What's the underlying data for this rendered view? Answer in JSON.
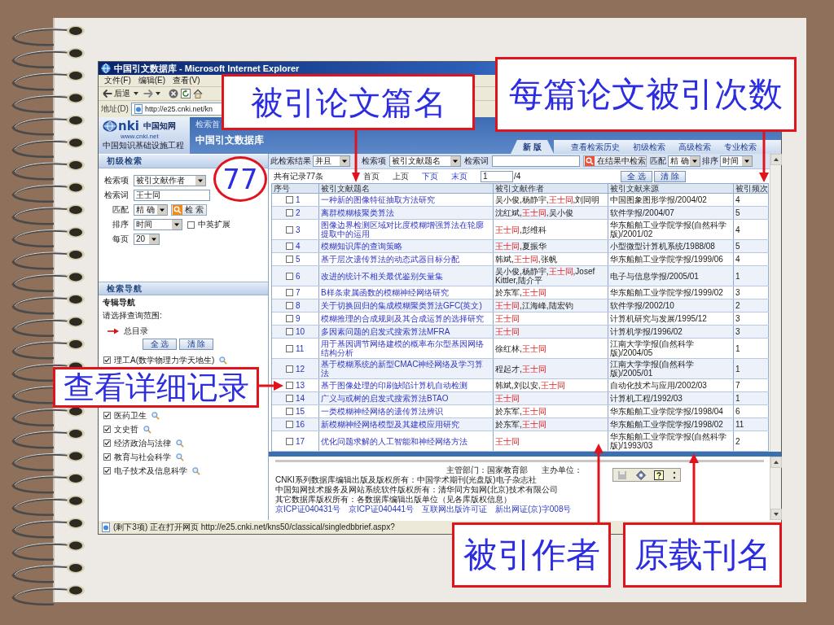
{
  "browser": {
    "title": "中国引文数据库 - Microsoft Internet Explorer",
    "menus": [
      "文件(F)",
      "编辑(E)",
      "查看(V)"
    ],
    "back": "后退",
    "address_label": "地址(D)",
    "url": "http://e25.cnki.net/kn",
    "status": "(剩下3项) 正在打开网页 http://e25.cnki.net/kns50/classical/singledbbrief.aspx?"
  },
  "site_header": {
    "logo": {
      "mark": "nki",
      "name": "中国知网",
      "url": "www.cnki.net",
      "tagline": "中国知识基础设施工程"
    },
    "home_link": "检索首",
    "database": "中国引文数据库",
    "version_tab": "新 版",
    "links": [
      "查看检索历史",
      "初级检索",
      "高级检索",
      "专业检索"
    ]
  },
  "basic_search": {
    "title": "初级检索",
    "field": {
      "label": "检索项",
      "value": "被引文献作者"
    },
    "term": {
      "label": "检索词",
      "value": "王士同"
    },
    "match": {
      "label": "匹配",
      "value": "精 确"
    },
    "search_button": "检 索",
    "sort": {
      "label": "排序",
      "value": "时间"
    },
    "expand": {
      "label": "中英扩展",
      "checked": false
    },
    "per_page": {
      "label": "每页",
      "value": "20"
    }
  },
  "navigation": {
    "title": "检索导航",
    "heading": "专辑导航",
    "prompt": "请选择查询范围:",
    "root": "总目录",
    "buttons": [
      "全 选",
      "清 除"
    ],
    "categories": [
      {
        "label": "理工A(数学物理力学天地生)",
        "checked": true
      },
      {
        "label": "医药卫生",
        "checked": true
      },
      {
        "label": "文史哲",
        "checked": true
      },
      {
        "label": "经济政治与法律",
        "checked": true
      },
      {
        "label": "教育与社会科学",
        "checked": true
      },
      {
        "label": "电子技术及信息科学",
        "checked": true
      }
    ]
  },
  "results": {
    "filter": {
      "logic_label": "此检索结果",
      "logic": "并且",
      "field_label": "检索项",
      "field": "被引文献题名",
      "term_label": "检索词",
      "search_button": "在结果中检索",
      "match_label": "匹配",
      "match": "精 确",
      "sort_label": "排序",
      "sort": "时间"
    },
    "pager": {
      "total": "共有记录77条",
      "links": [
        {
          "label": "首页",
          "disabled": true
        },
        {
          "label": "上页",
          "disabled": true
        },
        {
          "label": "下页",
          "disabled": false
        },
        {
          "label": "末页",
          "disabled": false
        }
      ],
      "page": "1",
      "pages": "/4",
      "buttons": [
        "全 选",
        "清 除"
      ]
    },
    "columns": [
      "序号",
      "被引文献题名",
      "被引文献作者",
      "被引文献来源",
      "被引频次"
    ],
    "rows": [
      {
        "checked": false,
        "number": "1",
        "title": "一种新的图像特征抽取方法研究",
        "authors": [
          {
            "text": "吴小俊,杨静宇,",
            "match": false
          },
          {
            "text": "王士同",
            "match": true
          },
          {
            "text": ",刘同明",
            "match": false
          }
        ],
        "source": "中国图象图形学报/2004/02",
        "count": "4"
      },
      {
        "checked": false,
        "number": "2",
        "title": "离群模糊核聚类算法",
        "authors": [
          {
            "text": "沈红斌,",
            "match": false
          },
          {
            "text": "王士同",
            "match": true
          },
          {
            "text": ",吴小俊",
            "match": false
          }
        ],
        "source": "软件学报/2004/07",
        "count": "5"
      },
      {
        "checked": false,
        "number": "3",
        "title": "图像边界检测区域对比度模糊增强算法在轮廓提取中的运用",
        "authors": [
          {
            "text": "王士同",
            "match": true
          },
          {
            "text": ",彭维科",
            "match": false
          }
        ],
        "source": "华东船舶工业学院学报(自然科学版)/2001/02",
        "count": "4"
      },
      {
        "checked": false,
        "number": "4",
        "title": "模糊知识库的查询策略",
        "authors": [
          {
            "text": "王士同",
            "match": true
          },
          {
            "text": ",夏振华",
            "match": false
          }
        ],
        "source": "小型微型计算机系统/1988/08",
        "count": "5"
      },
      {
        "checked": false,
        "number": "5",
        "title": "基于层次遗传算法的动态武器目标分配",
        "authors": [
          {
            "text": "韩斌,",
            "match": false
          },
          {
            "text": "王士同",
            "match": true
          },
          {
            "text": ",张帆",
            "match": false
          }
        ],
        "source": "华东船舶工业学院学报/1999/06",
        "count": "4"
      },
      {
        "checked": false,
        "number": "6",
        "title": "改进的统计不相关最优鉴别矢量集",
        "authors": [
          {
            "text": "吴小俊,杨静宇,",
            "match": false
          },
          {
            "text": "王士同",
            "match": true
          },
          {
            "text": ",Josef Kittler,陆介平",
            "match": false
          }
        ],
        "source": "电子与信息学报/2005/01",
        "count": "1"
      },
      {
        "checked": false,
        "number": "7",
        "title": "B样条隶属函数的模糊神经网络研究",
        "authors": [
          {
            "text": "於东军,",
            "match": false
          },
          {
            "text": "王士同",
            "match": true
          }
        ],
        "source": "华东船舶工业学院学报/1999/02",
        "count": "3"
      },
      {
        "checked": false,
        "number": "8",
        "title": "关于切换回归的集成模糊聚类算法GFC(英文)",
        "authors": [
          {
            "text": "王士同",
            "match": true
          },
          {
            "text": ",江海峰,陆宏钧",
            "match": false
          }
        ],
        "source": "软件学报/2002/10",
        "count": "2"
      },
      {
        "checked": false,
        "number": "9",
        "title": "模糊推理的合成规则及其合成运算的选择研究",
        "authors": [
          {
            "text": "王士同",
            "match": true
          }
        ],
        "source": "计算机研究与发展/1995/12",
        "count": "3"
      },
      {
        "checked": false,
        "number": "10",
        "title": "多因素问题的启发式搜索算法MFRA",
        "authors": [
          {
            "text": "王士同",
            "match": true
          }
        ],
        "source": "计算机学报/1996/02",
        "count": "3"
      },
      {
        "checked": false,
        "number": "11",
        "title": "用于基因调节网络建模的概率布尔型基因网络结构分析",
        "authors": [
          {
            "text": "徐红林,",
            "match": false
          },
          {
            "text": "王士同",
            "match": true
          }
        ],
        "source": "江南大学学报(自然科学版)/2004/05",
        "count": "1"
      },
      {
        "checked": false,
        "number": "12",
        "title": "基于模糊系统的新型CMAC神经网络及学习算法",
        "authors": [
          {
            "text": "程起才,",
            "match": false
          },
          {
            "text": "王士同",
            "match": true
          }
        ],
        "source": "江南大学学报(自然科学版)/2005/01",
        "count": "1"
      },
      {
        "checked": false,
        "number": "13",
        "title": "基于图像处理的印刷缺陷计算机自动检测",
        "authors": [
          {
            "text": "韩斌,刘以安,",
            "match": false
          },
          {
            "text": "王士同",
            "match": true
          }
        ],
        "source": "自动化技术与应用/2002/03",
        "count": "7"
      },
      {
        "checked": false,
        "number": "14",
        "title": "广义与或树的启发式搜索算法BTAO",
        "authors": [
          {
            "text": "王士同",
            "match": true
          }
        ],
        "source": "计算机工程/1992/03",
        "count": "1"
      },
      {
        "checked": false,
        "number": "15",
        "title": "一类模糊神经网络的遗传算法辨识",
        "authors": [
          {
            "text": "於东军,",
            "match": false
          },
          {
            "text": "王士同",
            "match": true
          }
        ],
        "source": "华东船舶工业学院学报/1998/04",
        "count": "6"
      },
      {
        "checked": false,
        "number": "16",
        "title": "新模糊神经网络模型及其建模应用研究",
        "authors": [
          {
            "text": "於东军,",
            "match": false
          },
          {
            "text": "王士同",
            "match": true
          }
        ],
        "source": "华东船舶工业学院学报/1998/02",
        "count": "11"
      },
      {
        "checked": false,
        "number": "17",
        "title": "优化问题求解的人工智能和神经网络方法",
        "authors": [
          {
            "text": "王士同",
            "match": true
          }
        ],
        "source": "华东船舶工业学院学报(自然科学版)/1993/03",
        "count": "2"
      }
    ]
  },
  "footer": {
    "department": "主管部门：国家教育部",
    "sponsor": "主办单位：",
    "lines": [
      "CNKI系列数据库编辑出版及版权所有：中国学术期刊(光盘版)电子杂志社",
      "中国知网技术服务及网站系统软件版权所有：清华同方知网(北京)技术有限公司",
      "其它数据库版权所有：各数据库编辑出版单位（见各库版权信息）"
    ],
    "links": [
      "京ICP证040431号",
      "京ICP证040441号",
      "互联网出版许可证",
      "新出网证(京)字008号"
    ]
  },
  "annotations": [
    {
      "kind": "box",
      "text": "被引论文篇名"
    },
    {
      "kind": "box",
      "text": "每篇论文被引次数"
    },
    {
      "kind": "circle",
      "text": "77"
    },
    {
      "kind": "box",
      "text": "查看详细记录"
    },
    {
      "kind": "box",
      "text": "被引作者"
    },
    {
      "kind": "box",
      "text": "原载刊名"
    }
  ]
}
